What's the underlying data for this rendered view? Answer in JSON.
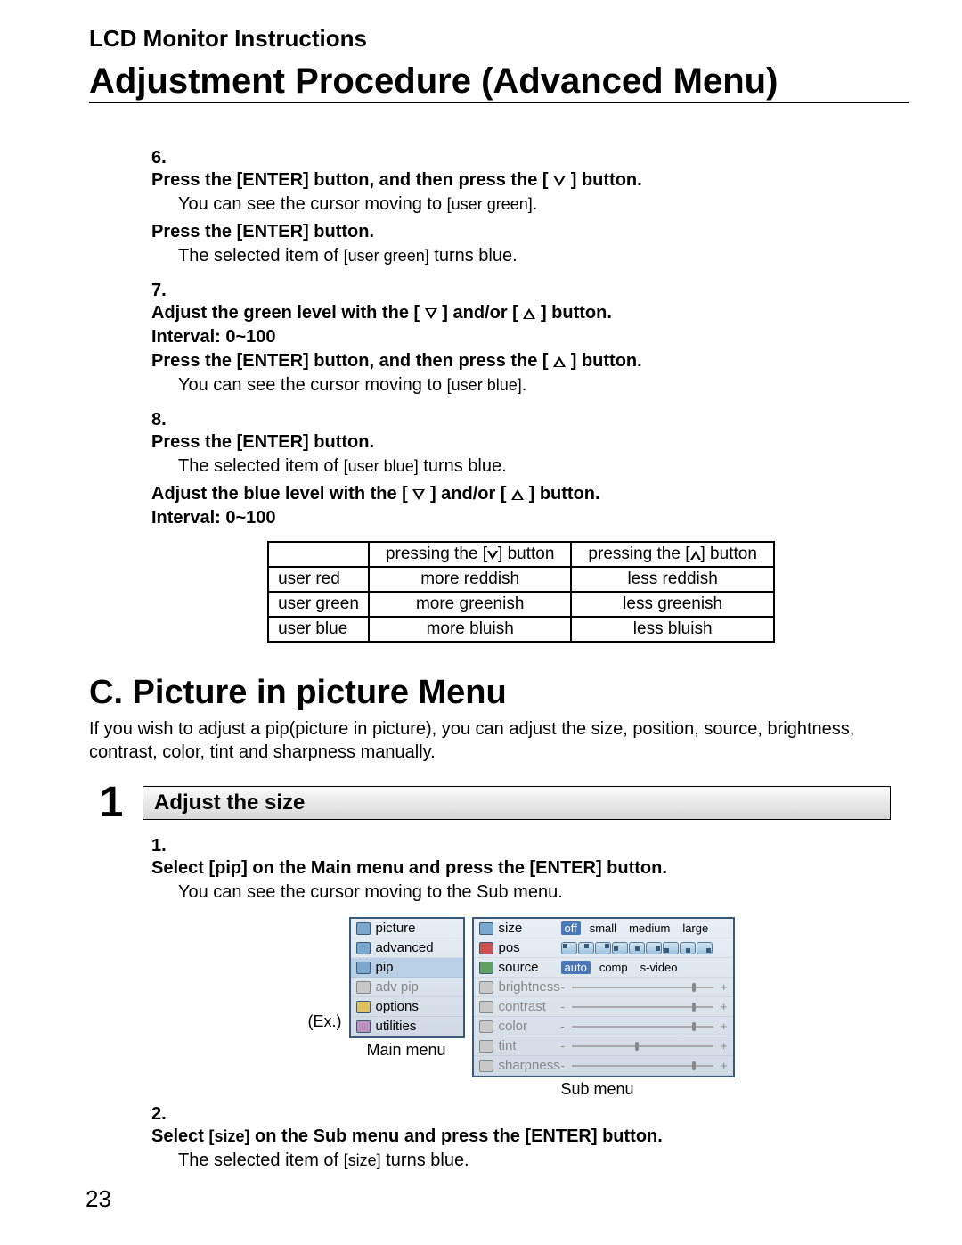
{
  "header": "LCD Monitor Instructions",
  "title": "Adjustment Procedure (Advanced Menu)",
  "pageNumber": "23",
  "steps": {
    "s6": {
      "num": "6.",
      "line1a": "Press the [ENTER] button, and then press the [",
      "line1b": "] button.",
      "note1a": "You can see the cursor moving to ",
      "note1b": "[user green]",
      "note1c": ".",
      "line2": "Press the [ENTER] button.",
      "note2a": "The selected item of ",
      "note2b": "[user green]",
      "note2c": " turns blue."
    },
    "s7": {
      "num": "7.",
      "line1a": "Adjust the green level with the [",
      "line1b": "] and/or [",
      "line1c": "] button.",
      "line2": "Interval: 0~100",
      "line3a": "Press the [ENTER] button, and then press the [",
      "line3b": "] button.",
      "note1a": "You can see the cursor moving to ",
      "note1b": "[user blue]",
      "note1c": "."
    },
    "s8": {
      "num": "8.",
      "line1": "Press the [ENTER] button.",
      "note1a": "The selected item of ",
      "note1b": "[user blue]",
      "note1c": " turns blue.",
      "line2a": "Adjust the blue level with the [",
      "line2b": "] and/or [",
      "line2c": "] button.",
      "line3": "Interval: 0~100"
    }
  },
  "table": {
    "h1": "",
    "h2a": "pressing the [",
    "h2b": "] button",
    "h3a": "pressing the [",
    "h3b": "] button",
    "rows": [
      {
        "c1": "user red",
        "c2": "more reddish",
        "c3": "less reddish"
      },
      {
        "c1": "user green",
        "c2": "more greenish",
        "c3": "less greenish"
      },
      {
        "c1": "user blue",
        "c2": "more bluish",
        "c3": "less bluish"
      }
    ]
  },
  "sectionC": {
    "title": "C. Picture in picture Menu",
    "desc": "If you wish to adjust a pip(picture in picture), you can adjust the size, position, source, brightness, contrast, color, tint and sharpness manually.",
    "sub": {
      "num": "1",
      "title": "Adjust the size",
      "step1": {
        "num": "1.",
        "bold": "Select [pip] on the Main menu and press the [ENTER] button.",
        "note": "You can see the cursor moving to the Sub menu."
      },
      "step2": {
        "num": "2.",
        "bolda": "Select ",
        "boldb": "[size]",
        "boldc": " on the Sub menu and press the [ENTER] button.",
        "notea": "The selected item of ",
        "noteb": "[size]",
        "notec": " turns blue."
      }
    }
  },
  "menuExample": {
    "exLabel": "(Ex.)",
    "mainCaption": "Main menu",
    "subCaption": "Sub menu",
    "mainItems": [
      "picture",
      "advanced",
      "pip",
      "adv pip",
      "options",
      "utilities"
    ],
    "sub": {
      "size": {
        "label": "size",
        "opts": [
          "off",
          "small",
          "medium",
          "large"
        ]
      },
      "pos": {
        "label": "pos"
      },
      "source": {
        "label": "source",
        "opts": [
          "auto",
          "comp",
          "s-video"
        ]
      },
      "brightness": "brightness",
      "contrast": "contrast",
      "color": "color",
      "tint": "tint",
      "sharpness": "sharpness"
    }
  }
}
